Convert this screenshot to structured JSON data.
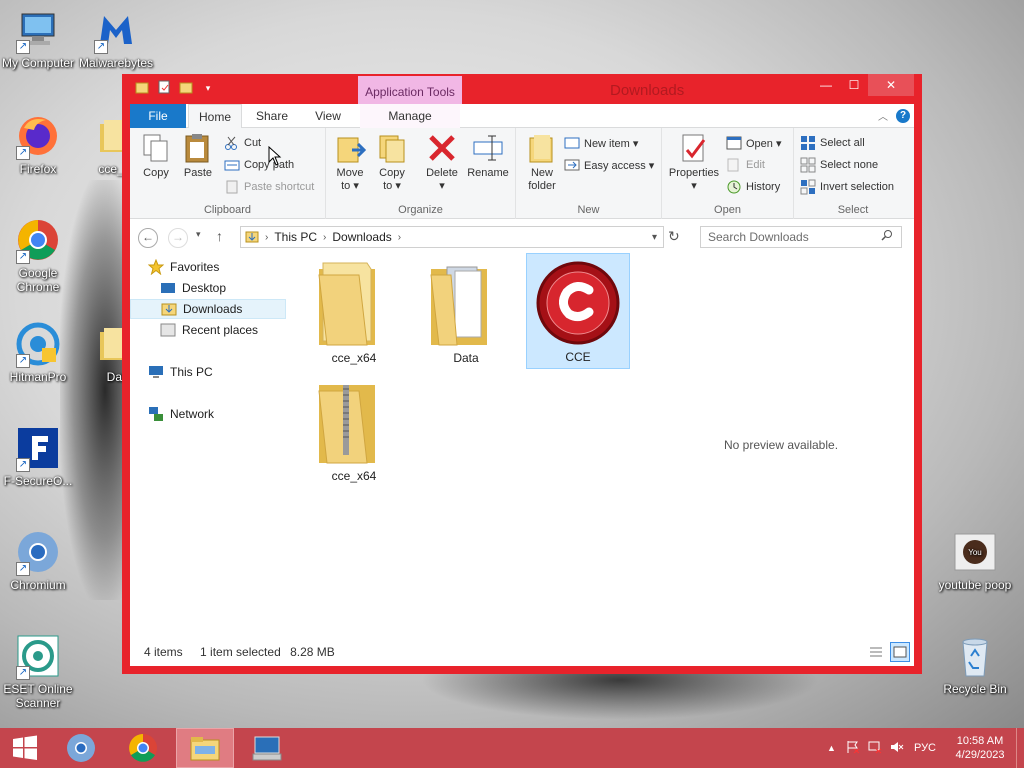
{
  "desktop": {
    "icons_left": [
      {
        "label": "My Computer",
        "icon": "computer-icon"
      },
      {
        "label": "Firefox",
        "icon": "firefox-icon"
      },
      {
        "label": "Google Chrome",
        "icon": "chrome-icon"
      },
      {
        "label": "HitmanPro",
        "icon": "hitmanpro-icon"
      },
      {
        "label": "F-SecureO...",
        "icon": "fsecure-icon"
      },
      {
        "label": "Chromium",
        "icon": "chromium-icon"
      },
      {
        "label": "ESET Online Scanner",
        "icon": "eset-icon"
      }
    ],
    "icons_col2": [
      {
        "label": "Malwarebytes",
        "icon": "malwarebytes-icon"
      },
      {
        "label": "cce_...",
        "icon": "folder-icon"
      },
      {
        "label": "Dat",
        "icon": "folder-icon"
      }
    ],
    "icons_right": [
      {
        "label": "youtube poop",
        "icon": "youtube-icon"
      },
      {
        "label": "Recycle Bin",
        "icon": "recycle-bin-icon"
      }
    ]
  },
  "window": {
    "title": "Downloads",
    "context_tab": "Application Tools",
    "tabs": [
      "File",
      "Home",
      "Share",
      "View",
      "Manage"
    ],
    "accent": "#e8232b"
  },
  "ribbon": {
    "clipboard": {
      "label": "Clipboard",
      "copy": "Copy",
      "paste": "Paste",
      "cut": "Cut",
      "copy_path": "Copy path",
      "paste_shortcut": "Paste shortcut"
    },
    "organize": {
      "label": "Organize",
      "move_to": "Move",
      "move_to2": "to ▾",
      "copy_to": "Copy",
      "copy_to2": "to ▾",
      "delete": "Delete",
      "delete2": "▾",
      "rename": "Rename"
    },
    "new": {
      "label": "New",
      "new_folder": "New",
      "new_folder2": "folder",
      "new_item": "New item ▾",
      "easy_access": "Easy access ▾"
    },
    "open": {
      "label": "Open",
      "properties": "Properties",
      "properties2": "▾",
      "open": "Open ▾",
      "edit": "Edit",
      "history": "History"
    },
    "select": {
      "label": "Select",
      "select_all": "Select all",
      "select_none": "Select none",
      "invert": "Invert selection"
    }
  },
  "address": {
    "crumb1": "This PC",
    "crumb2": "Downloads",
    "search_placeholder": "Search Downloads"
  },
  "nav": {
    "favorites": "Favorites",
    "desktop": "Desktop",
    "downloads": "Downloads",
    "recent": "Recent places",
    "this_pc": "This PC",
    "network": "Network"
  },
  "files": [
    {
      "name": "cce_x64",
      "type": "folder"
    },
    {
      "name": "Data",
      "type": "folder"
    },
    {
      "name": "CCE",
      "type": "application",
      "selected": true
    },
    {
      "name": "cce_x64",
      "type": "zip"
    }
  ],
  "preview": "No preview available.",
  "status": {
    "items": "4 items",
    "selected": "1 item selected",
    "size": "8.28 MB"
  },
  "taskbar": {
    "lang": "РУС",
    "time": "10:58 AM",
    "date": "4/29/2023"
  }
}
